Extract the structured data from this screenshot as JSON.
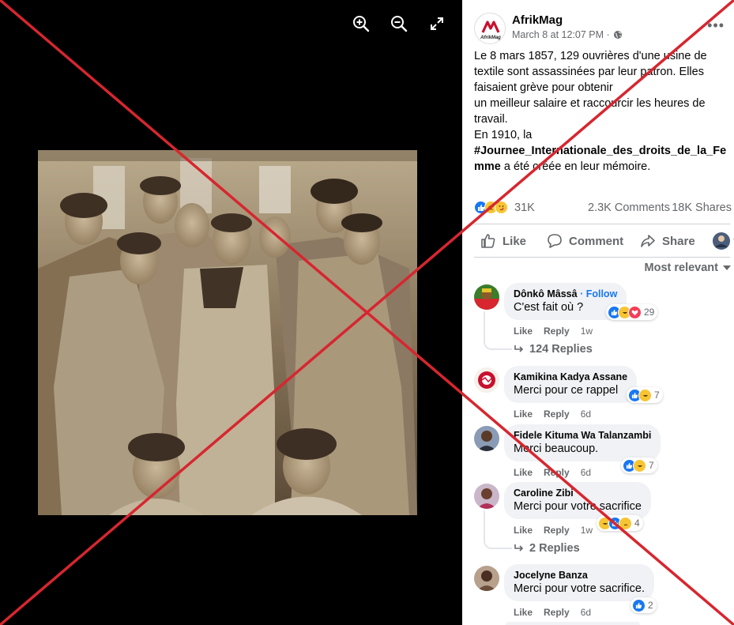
{
  "viewer": {
    "tools": [
      {
        "name": "zoom-in-icon"
      },
      {
        "name": "zoom-out-icon"
      },
      {
        "name": "fullscreen-icon"
      }
    ]
  },
  "post": {
    "page_name": "AfrikMag",
    "logo_text": "AfrikMag",
    "meta": "March 8 at 12:07 PM ·",
    "text_lines": [
      "Le 8 mars 1857, 129 ouvrières d'une usine de textile sont assassinées par leur patron. Elles faisaient grève pour obtenir",
      "un meilleur salaire et raccourcir les heures de travail.",
      "En 1910, la"
    ],
    "hashtag": "#Journee_Internationale_des_droits_de_la_Femme",
    "text_tail": " a été créée en leur mémoire.",
    "reactions_count": "31K",
    "comments_count": "2.3K Comments",
    "shares_count": "18K Shares",
    "actions": {
      "like": "Like",
      "comment": "Comment",
      "share": "Share"
    },
    "sort_label": "Most relevant"
  },
  "comments": [
    {
      "name": "Dônkô Mâssâ",
      "follow": "· Follow",
      "text": "C'est fait où ?",
      "reaction_count": "29",
      "like": "Like",
      "reply": "Reply",
      "time": "1w",
      "replies": "124 Replies"
    },
    {
      "name": "Kamikina Kadya Assane",
      "text": "Merci pour ce rappel",
      "reaction_count": "7",
      "like": "Like",
      "reply": "Reply",
      "time": "6d"
    },
    {
      "name": "Fidele Kituma Wa Talanzambi",
      "text": "Merci beaucoup.",
      "reaction_count": "7",
      "like": "Like",
      "reply": "Reply",
      "time": "6d"
    },
    {
      "name": "Caroline Zibi",
      "text": "Merci pour votre sacrifice",
      "reaction_count": "4",
      "like": "Like",
      "reply": "Reply",
      "time": "1w",
      "replies": "2 Replies"
    },
    {
      "name": "Jocelyne Banza",
      "text": "Merci pour votre sacrifice.",
      "reaction_count": "2",
      "like": "Like",
      "reply": "Reply",
      "time": "6d"
    }
  ],
  "colors": {
    "facebook_blue": "#1877f2",
    "cross_red": "#d7262f",
    "muted_text": "#65676b",
    "bubble_bg": "#f0f2f5"
  }
}
